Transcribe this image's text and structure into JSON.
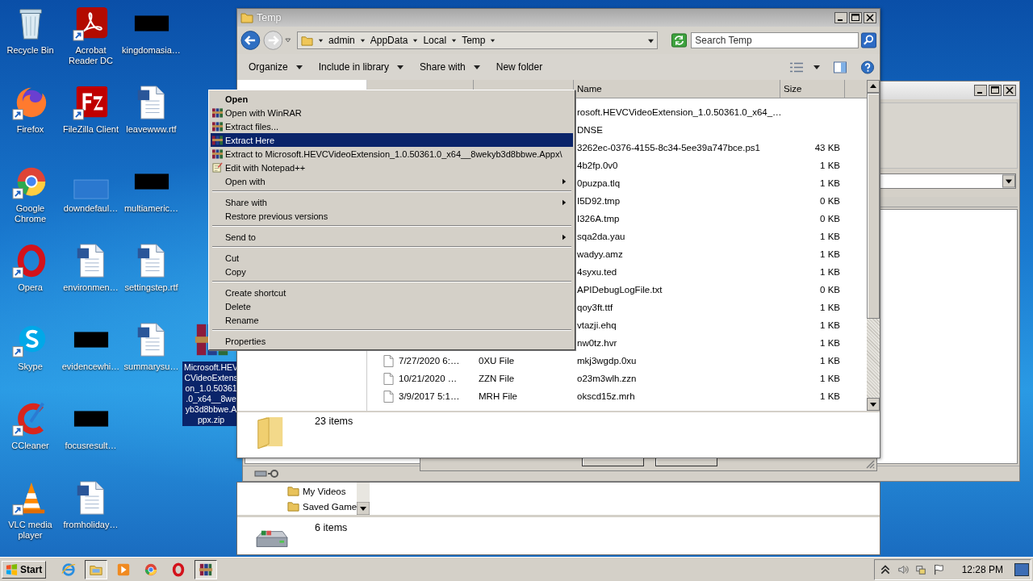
{
  "desktop_columns": [
    [
      {
        "kind": "recycle",
        "shortcut": false,
        "lines": [
          "Recycle Bin"
        ],
        "selected": false
      },
      {
        "kind": "firefox",
        "shortcut": true,
        "lines": [
          "Firefox"
        ],
        "selected": false
      },
      {
        "kind": "chrome",
        "shortcut": true,
        "lines": [
          "Google",
          "Chrome"
        ],
        "selected": false
      },
      {
        "kind": "opera",
        "shortcut": true,
        "lines": [
          "Opera"
        ],
        "selected": false
      },
      {
        "kind": "skype",
        "shortcut": true,
        "lines": [
          "Skype"
        ],
        "selected": false
      },
      {
        "kind": "ccleaner",
        "shortcut": true,
        "lines": [
          "CCleaner"
        ],
        "selected": false
      },
      {
        "kind": "vlc",
        "shortcut": true,
        "lines": [
          "VLC media",
          "player"
        ],
        "selected": false
      }
    ],
    [
      {
        "kind": "acrobat",
        "shortcut": true,
        "lines": [
          "Acrobat",
          "Reader DC"
        ],
        "selected": false
      },
      {
        "kind": "filezilla",
        "shortcut": true,
        "lines": [
          "FileZilla Client"
        ],
        "selected": false
      },
      {
        "kind": "blank",
        "shortcut": false,
        "lines": [
          "downdefaul…"
        ],
        "selected": false
      },
      {
        "kind": "word",
        "shortcut": false,
        "lines": [
          "environmen…"
        ],
        "selected": false
      },
      {
        "kind": "redacted",
        "shortcut": false,
        "lines": [
          "evidencewhi…"
        ],
        "selected": false
      },
      {
        "kind": "redacted",
        "shortcut": false,
        "lines": [
          "focusresult…"
        ],
        "selected": false
      },
      {
        "kind": "word",
        "shortcut": false,
        "lines": [
          "fromholiday…"
        ],
        "selected": false
      }
    ],
    [
      {
        "kind": "redacted",
        "shortcut": false,
        "lines": [
          "kingdomasia…"
        ],
        "selected": false
      },
      {
        "kind": "word",
        "shortcut": false,
        "lines": [
          "leavewww.rtf"
        ],
        "selected": false
      },
      {
        "kind": "redacted",
        "shortcut": false,
        "lines": [
          "multiameric…"
        ],
        "selected": false
      },
      {
        "kind": "word",
        "shortcut": false,
        "lines": [
          "settingstep.rtf"
        ],
        "selected": false
      },
      {
        "kind": "word",
        "shortcut": false,
        "lines": [
          "summarysu…"
        ],
        "selected": false
      }
    ],
    [
      {
        "kind": "archive",
        "shortcut": false,
        "lines": [
          "Microsoft.HEV",
          "CVideoExtens",
          "on_1.0.50361",
          ".0_x64__8we",
          "yb3d8bbwe.A",
          "ppx.zip"
        ],
        "selected": true
      }
    ]
  ],
  "explorer": {
    "title": "Temp",
    "breadcrumb": [
      "admin",
      "AppData",
      "Local",
      "Temp"
    ],
    "search": {
      "placeholder": "Search Temp"
    },
    "toolbar": [
      {
        "label": "Organize",
        "menu": true
      },
      {
        "label": "Include in library",
        "menu": true
      },
      {
        "label": "Share with",
        "menu": true
      },
      {
        "label": "New folder",
        "menu": false
      }
    ],
    "columns": [
      "Name",
      "Size"
    ],
    "files": [
      {
        "name": "rosoft.HEVCVideoExtension_1.0.50361.0_x64_…"
      },
      {
        "name": "DNSE"
      },
      {
        "name": "3262ec-0376-4155-8c34-5ee39a747bce.ps1",
        "size": "43 KB"
      },
      {
        "name": "4b2fp.0v0",
        "size": "1 KB"
      },
      {
        "name": "0puzpa.tlq",
        "size": "1 KB"
      },
      {
        "name": "I5D92.tmp",
        "size": "0 KB"
      },
      {
        "name": "I326A.tmp",
        "size": "0 KB"
      },
      {
        "name": "sqa2da.yau",
        "size": "1 KB"
      },
      {
        "name": "wadyy.amz",
        "size": "1 KB"
      },
      {
        "name": "4syxu.ted",
        "size": "1 KB"
      },
      {
        "name": "APIDebugLogFile.txt",
        "size": "0 KB"
      },
      {
        "name": "qoy3ft.ttf",
        "size": "1 KB"
      },
      {
        "name": "vtazji.ehq",
        "size": "1 KB"
      },
      {
        "name": "nw0tz.hvr",
        "size": "1 KB"
      },
      {
        "date": "7/27/2020 6:…",
        "type": "0XU File",
        "name": "mkj3wgdp.0xu",
        "size": "1 KB"
      },
      {
        "date": "10/21/2020 …",
        "type": "ZZN File",
        "name": "o23m3wlh.zzn",
        "size": "1 KB"
      },
      {
        "date": "3/9/2017 5:1…",
        "type": "MRH File",
        "name": "okscd15z.mrh",
        "size": "1 KB"
      }
    ],
    "status": "23 items"
  },
  "context_menu": [
    {
      "kind": "item",
      "label": "Open",
      "default": true,
      "selected": false,
      "submenu": false
    },
    {
      "kind": "archive_item",
      "label": "Open with WinRAR",
      "default": false,
      "selected": false,
      "submenu": false
    },
    {
      "kind": "archive_item",
      "label": "Extract files...",
      "default": false,
      "selected": false,
      "submenu": false
    },
    {
      "kind": "archive_item",
      "label": "Extract Here",
      "default": false,
      "selected": true,
      "submenu": false
    },
    {
      "kind": "archive_item",
      "label": "Extract to Microsoft.HEVCVideoExtension_1.0.50361.0_x64__8wekyb3d8bbwe.Appx\\",
      "default": false,
      "selected": false,
      "submenu": false
    },
    {
      "kind": "notepad_item",
      "label": "Edit with Notepad++",
      "default": false,
      "selected": false,
      "submenu": false
    },
    {
      "kind": "item",
      "label": "Open with",
      "default": false,
      "selected": false,
      "submenu": true
    },
    {
      "kind": "separator"
    },
    {
      "kind": "item",
      "label": "Share with",
      "default": false,
      "selected": false,
      "submenu": true
    },
    {
      "kind": "item",
      "label": "Restore previous versions",
      "default": false,
      "selected": false,
      "submenu": false
    },
    {
      "kind": "separator"
    },
    {
      "kind": "item",
      "label": "Send to",
      "default": false,
      "selected": false,
      "submenu": true
    },
    {
      "kind": "separator"
    },
    {
      "kind": "item",
      "label": "Cut",
      "default": false,
      "selected": false,
      "submenu": false
    },
    {
      "kind": "item",
      "label": "Copy",
      "default": false,
      "selected": false,
      "submenu": false
    },
    {
      "kind": "separator"
    },
    {
      "kind": "item",
      "label": "Create shortcut",
      "default": false,
      "selected": false,
      "submenu": false
    },
    {
      "kind": "item",
      "label": "Delete",
      "default": false,
      "selected": false,
      "submenu": false
    },
    {
      "kind": "item",
      "label": "Rename",
      "default": false,
      "selected": false,
      "submenu": false
    },
    {
      "kind": "separator"
    },
    {
      "kind": "item",
      "label": "Properties",
      "default": false,
      "selected": false,
      "submenu": false
    }
  ],
  "background_explorer": {
    "nav_items": [
      "My Videos",
      "Saved Game"
    ],
    "status": "6 items"
  },
  "taskbar": {
    "start": "Start",
    "apps": [
      {
        "kind": "ie",
        "selected": false
      },
      {
        "kind": "explorer",
        "selected": true
      },
      {
        "kind": "media",
        "selected": false
      },
      {
        "kind": "chrome",
        "selected": false
      },
      {
        "kind": "opera",
        "selected": false
      },
      {
        "kind": "winrar",
        "selected": true
      }
    ],
    "clock": "12:28 PM"
  }
}
